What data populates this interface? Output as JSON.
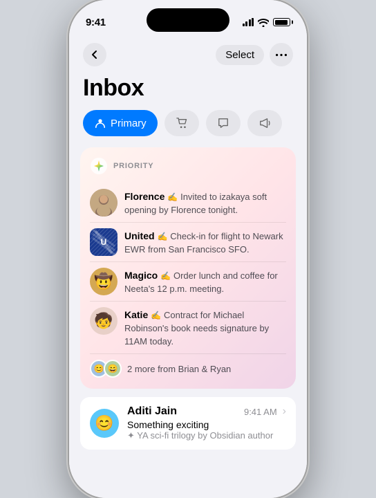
{
  "phone": {
    "time": "9:41",
    "dynamic_island": true
  },
  "nav": {
    "back_label": "‹",
    "select_label": "Select",
    "more_label": "•••"
  },
  "header": {
    "title": "Inbox"
  },
  "tabs": [
    {
      "id": "primary",
      "label": "Primary",
      "icon": "person",
      "active": true
    },
    {
      "id": "shopping",
      "label": "Shopping",
      "icon": "cart",
      "active": false
    },
    {
      "id": "messages",
      "label": "Messages",
      "icon": "bubble",
      "active": false
    },
    {
      "id": "updates",
      "label": "Updates",
      "icon": "megaphone",
      "active": false
    }
  ],
  "priority": {
    "section_label": "PRIORITY",
    "items": [
      {
        "sender": "Florence",
        "snippet": "Invited to izakaya soft opening by Florence tonight.",
        "avatar_emoji": "👩",
        "avatar_type": "florence"
      },
      {
        "sender": "United",
        "snippet": "Check-in for flight to Newark EWR from San Francisco SFO.",
        "avatar_type": "united"
      },
      {
        "sender": "Magico",
        "snippet": "Order lunch and coffee for Neeta's 12 p.m. meeting.",
        "avatar_emoji": "🤠",
        "avatar_type": "magico"
      },
      {
        "sender": "Katie",
        "snippet": "Contract for Michael Robinson's book needs signature by 11AM today.",
        "avatar_emoji": "🧑‍🎨",
        "avatar_type": "katie"
      }
    ],
    "more_text": "2 more from Brian & Ryan"
  },
  "inbox_items": [
    {
      "sender": "Aditi Jain",
      "time": "9:41 AM",
      "subject": "Something exciting",
      "preview": "✦ YA sci-fi trilogy by Obsidian author",
      "avatar_emoji": "😊",
      "avatar_bg": "#5ac8fa"
    }
  ]
}
